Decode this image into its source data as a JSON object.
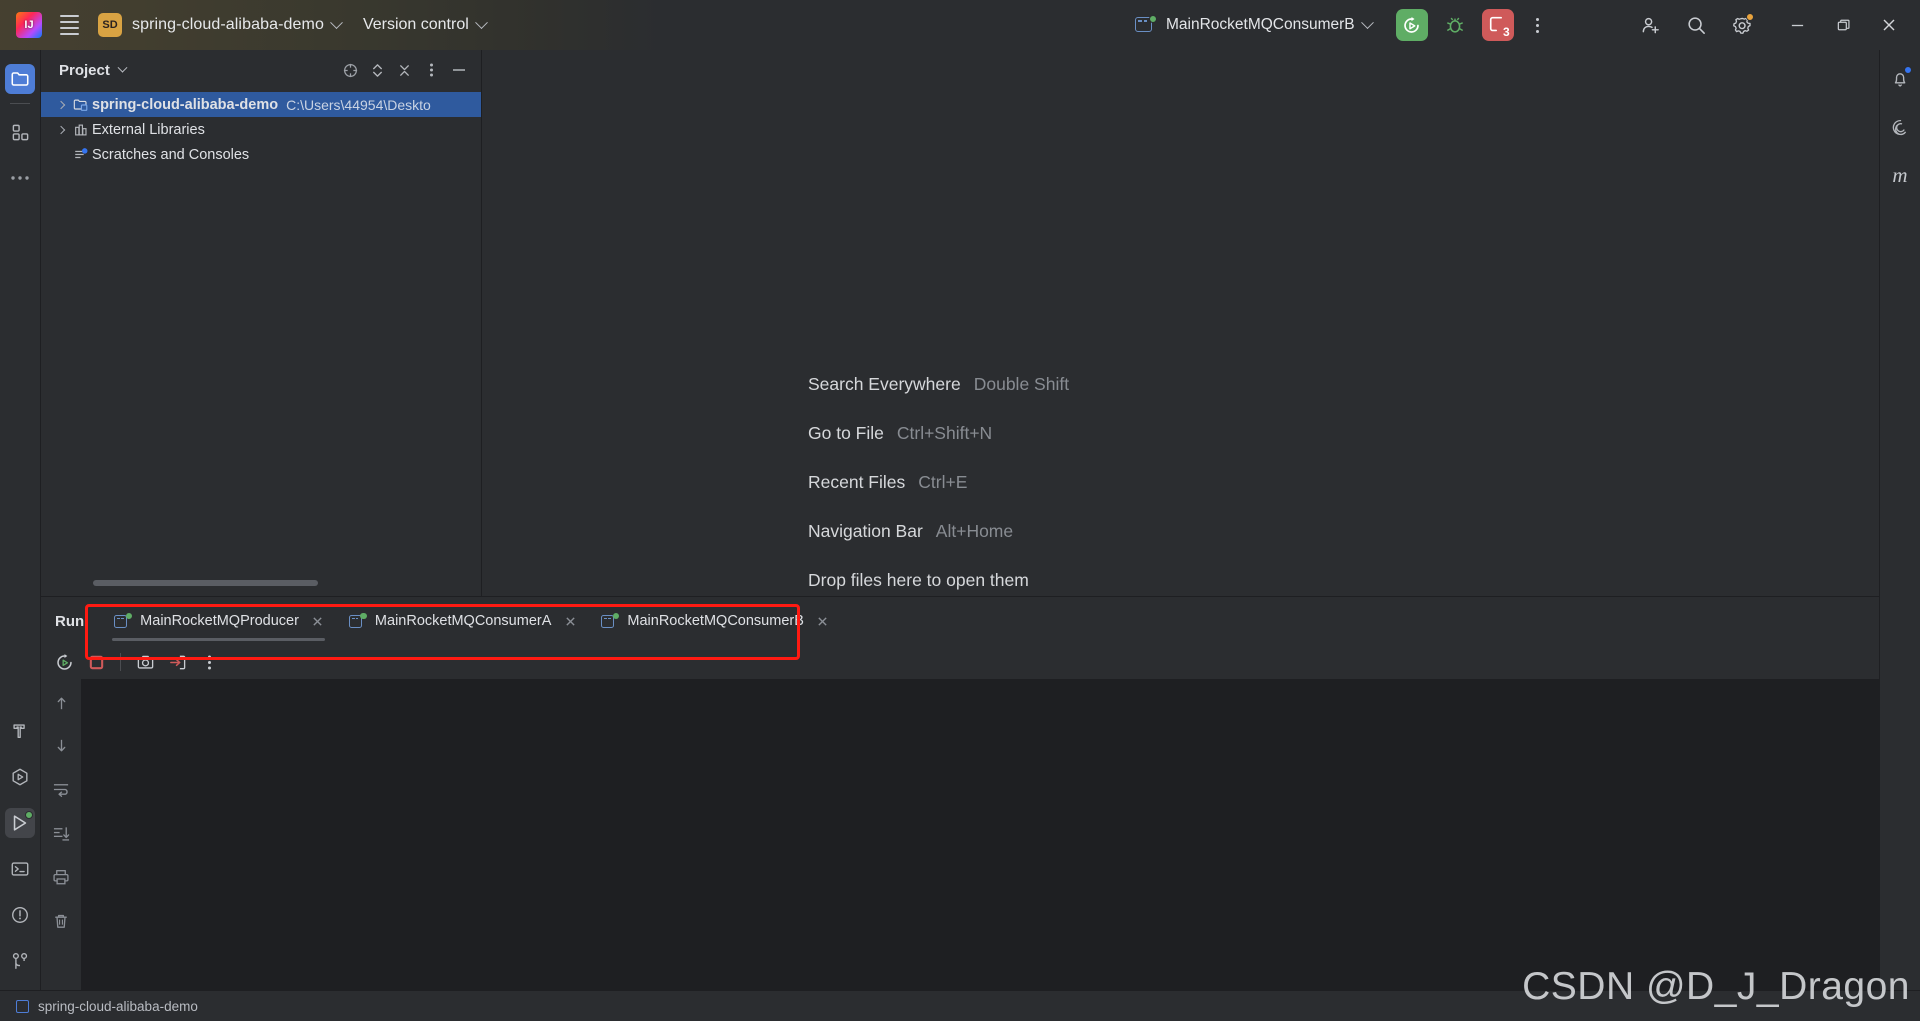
{
  "toolbar": {
    "app_logo": "intellij-idea-logo",
    "menu_icon": "hamburger-menu-icon",
    "project_badge": "SD",
    "project_name": "spring-cloud-alibaba-demo",
    "version_control": "Version control",
    "run_config_name": "MainRocketMQConsumerB",
    "run_button": "run-icon",
    "debug_button": "debug-icon",
    "stop_count": "3",
    "more_button": "kebab-menu-icon",
    "add_user": "add-user-icon",
    "search": "search-icon",
    "settings": "gear-icon",
    "minimize": "minimize-icon",
    "maximize": "maximize-icon",
    "close": "close-icon"
  },
  "left_stripe": {
    "items": [
      {
        "name": "project",
        "icon": "folder-icon",
        "active": true
      },
      {
        "name": "structure",
        "icon": "squares-icon",
        "active": false
      },
      {
        "name": "more-tool-windows",
        "icon": "ellipsis-icon",
        "active": false
      }
    ],
    "bottom_items": [
      {
        "name": "build",
        "icon": "hammer-icon",
        "active": false
      },
      {
        "name": "services",
        "icon": "services-icon",
        "active": false
      },
      {
        "name": "run",
        "icon": "run-play-icon",
        "active": true
      },
      {
        "name": "terminal",
        "icon": "terminal-icon",
        "active": false
      },
      {
        "name": "problems",
        "icon": "warning-circle-icon",
        "active": false
      },
      {
        "name": "version-control",
        "icon": "git-branch-icon",
        "active": false
      }
    ]
  },
  "right_stripe": {
    "items": [
      {
        "name": "notifications",
        "icon": "bell-icon"
      },
      {
        "name": "ai-assistant",
        "icon": "spiral-icon"
      },
      {
        "name": "maven",
        "icon": "maven-m-icon"
      }
    ]
  },
  "project_panel": {
    "title": "Project",
    "header_icons": [
      "select-opened-file-icon",
      "expand-collapse-icon",
      "collapse-all-icon",
      "options-kebab-icon",
      "hide-icon"
    ],
    "tree": [
      {
        "label": "spring-cloud-alibaba-demo",
        "path": "C:\\Users\\44954\\Deskto",
        "icon": "project-folder-icon",
        "expandable": true,
        "selected": true,
        "indent": 0
      },
      {
        "label": "External Libraries",
        "path": "",
        "icon": "libraries-icon",
        "expandable": true,
        "selected": false,
        "indent": 0
      },
      {
        "label": "Scratches and Consoles",
        "path": "",
        "icon": "scratches-icon",
        "expandable": false,
        "selected": false,
        "indent": 0
      }
    ]
  },
  "editor": {
    "hints": [
      {
        "action": "Search Everywhere",
        "key": "Double Shift"
      },
      {
        "action": "Go to File",
        "key": "Ctrl+Shift+N"
      },
      {
        "action": "Recent Files",
        "key": "Ctrl+E"
      },
      {
        "action": "Navigation Bar",
        "key": "Alt+Home"
      },
      {
        "action": "Drop files here to open them",
        "key": ""
      }
    ]
  },
  "run_window": {
    "title": "Run",
    "tabs": [
      {
        "label": "MainRocketMQProducer",
        "active": true,
        "status": "running"
      },
      {
        "label": "MainRocketMQConsumerA",
        "active": false,
        "status": "running"
      },
      {
        "label": "MainRocketMQConsumerB",
        "active": false,
        "status": "running"
      }
    ],
    "close_icon": "close-tab-icon",
    "toolbar": [
      {
        "name": "rerun",
        "icon": "rerun-icon"
      },
      {
        "name": "stop",
        "icon": "stop-icon"
      },
      {
        "name": "thread-dump",
        "icon": "camera-icon"
      },
      {
        "name": "export",
        "icon": "export-icon"
      },
      {
        "name": "more",
        "icon": "kebab-menu-icon"
      }
    ],
    "gutter": [
      {
        "name": "up",
        "icon": "arrow-up-icon"
      },
      {
        "name": "down",
        "icon": "arrow-down-icon"
      },
      {
        "name": "soft-wrap",
        "icon": "soft-wrap-icon"
      },
      {
        "name": "scroll-to-end",
        "icon": "scroll-to-end-icon"
      },
      {
        "name": "print",
        "icon": "print-icon"
      },
      {
        "name": "clear-all",
        "icon": "trash-icon"
      }
    ],
    "console_text": ""
  },
  "status_bar": {
    "project": "spring-cloud-alibaba-demo",
    "icon": "project-square-icon"
  },
  "watermark": {
    "text": "CSDN @D_J_Dragon"
  },
  "colors": {
    "background": "#2b2d30",
    "console_background": "#1e1f22",
    "selection": "#2f5a9e",
    "accent_blue": "#4e7dd6",
    "run_green": "#5fad65",
    "stop_red": "#cf5a5a",
    "annotation_red": "#ff1a12",
    "badge_orange": "#d9a343",
    "notification_blue": "#3574f0"
  }
}
